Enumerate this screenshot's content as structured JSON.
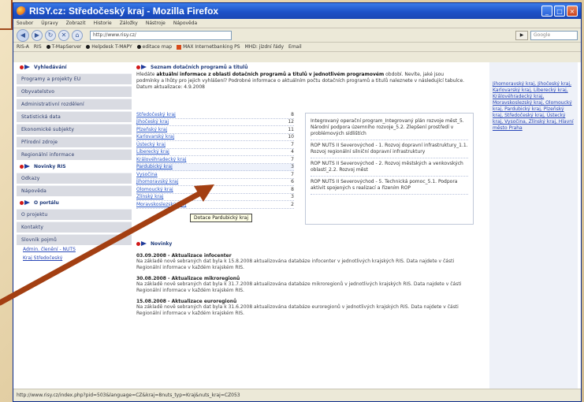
{
  "window": {
    "title": "RISY.cz: Středočeský kraj - Mozilla Firefox"
  },
  "menubar": {
    "items": [
      "Soubor",
      "Úpravy",
      "Zobrazit",
      "Historie",
      "Záložky",
      "Nástroje",
      "Nápověda"
    ]
  },
  "navbar": {
    "url": "http://www.risy.cz/",
    "go": "▶",
    "search_placeholder": "Google"
  },
  "bookmarks": {
    "items": [
      "RIS-A",
      "RIS",
      "T-MapServer",
      "Helpdesk T-MAPY",
      "editace map",
      "MAX Internetbanking PS",
      "MHD: jízdní řády",
      "Email"
    ]
  },
  "sidebar": {
    "section1": "Vyhledávání",
    "items1": [
      "Programy a projekty EU",
      "Obyvatelstvo",
      "Administrativní rozdělení",
      "Statistická data",
      "Ekonomické subjekty",
      "Přírodní zdroje",
      "Regionální informace"
    ],
    "section2": "Novinky RIS",
    "items2": [
      "Odkazy",
      "Nápověda"
    ],
    "section3": "O portálu",
    "items3": [
      "O projektu",
      "Kontakty",
      "Slovník pojmů"
    ],
    "links": [
      "Admin. členění - NUTS",
      "Kraj Středočeský"
    ]
  },
  "main": {
    "section_title": "Seznam dotačních programů a titulů",
    "intro_bold": "aktuální informace z oblasti dotačních programů a titulů v jednotlivém programovém",
    "intro_pre": "Hledáte",
    "intro_rest": "období. Nevíte, jaké jsou podmínky a lhůty pro jejich vyhlášení? Podrobné informace o aktuálním počtu dotačních programů a titulů naleznete v následující tabulce.",
    "date": "Datum aktualizace: 4.9.2008",
    "regions": [
      {
        "name": "Středočeský kraj",
        "count": "8"
      },
      {
        "name": "Jihočeský kraj",
        "count": "12"
      },
      {
        "name": "Plzeňský kraj",
        "count": "11"
      },
      {
        "name": "Karlovarský kraj",
        "count": "10"
      },
      {
        "name": "Ústecký kraj",
        "count": "7"
      },
      {
        "name": "Liberecký kraj",
        "count": "4"
      },
      {
        "name": "Královéhradecký kraj",
        "count": "7"
      },
      {
        "name": "Pardubický kraj",
        "count": "3"
      },
      {
        "name": "Vysočina",
        "count": "7"
      },
      {
        "name": "Jihomoravský kraj",
        "count": "6"
      },
      {
        "name": "Olomoucký kraj",
        "count": "8"
      },
      {
        "name": "Zlínský kraj",
        "count": "3"
      },
      {
        "name": "Moravskoslezský kraj",
        "count": "2"
      }
    ],
    "tooltip": "Dotace Pardubický kraj",
    "programs": [
      "Integrovaný operační program_Integrovaný plán rozvoje měst_5. Národní podpora územního rozvoje_5.2. Zlepšení prostředí v problémových sídlištích",
      "ROP NUTS II Severovýchod - 1. Rozvoj dopravní infrastruktury_1.1. Rozvoj regionální silniční dopravní infrastruktury",
      "ROP NUTS II Severovýchod - 2. Rozvoj městských a venkovských oblastí_2.2. Rozvoj měst",
      "ROP NUTS II Severovýchod - 5. Technická pomoc_5.1. Podpora aktivit spojených s realizací a řízením ROP"
    ],
    "news_title": "Novinky",
    "news": [
      {
        "date_title": "03.09.2008 - Aktualizace infocenter",
        "text": "Na základě nově sebraných dat byla k 15.8.2008 aktualizována databáze infocenter v jednotlivých krajských RIS. Data najdete v části Regionální informace v každém krajském RIS."
      },
      {
        "date_title": "30.08.2008 - Aktualizace mikroregionů",
        "text": "Na základě nově sebraných dat byla k 31.7.2008 aktualizována databáze mikroregionů v jednotlivých krajských RIS. Data najdete v části Regionální informace v každém krajském RIS."
      },
      {
        "date_title": "15.08.2008 - Aktualizace euroregionů",
        "text": "Na základě nově sebraných dat byla k 31.6.2008 aktualizována databáze euroregionů v jednotlivých krajských RIS. Data najdete v části Regionální informace v každém krajském RIS."
      }
    ]
  },
  "rightcol": {
    "links": "Jihomoravský kraj, Jihočeský kraj, Karlovarský kraj, Liberecký kraj, Královéhradecký kraj, Moravskoslezský kraj, Olomoucký kraj, Pardubický kraj, Plzeňský kraj, Středočeský kraj, Ústecký kraj, Vysočina, Zlínský kraj, Hlavní město Praha"
  },
  "statusbar": {
    "text": "http://www.risy.cz/index.php?pid=503&language=CZ&kraj=8nuts_typ=Kraj&nuts_kraj=CZ053"
  },
  "colors": {
    "arrow": "#a33f12",
    "titlebar": "#1d52c8",
    "link": "#2a58c8"
  }
}
